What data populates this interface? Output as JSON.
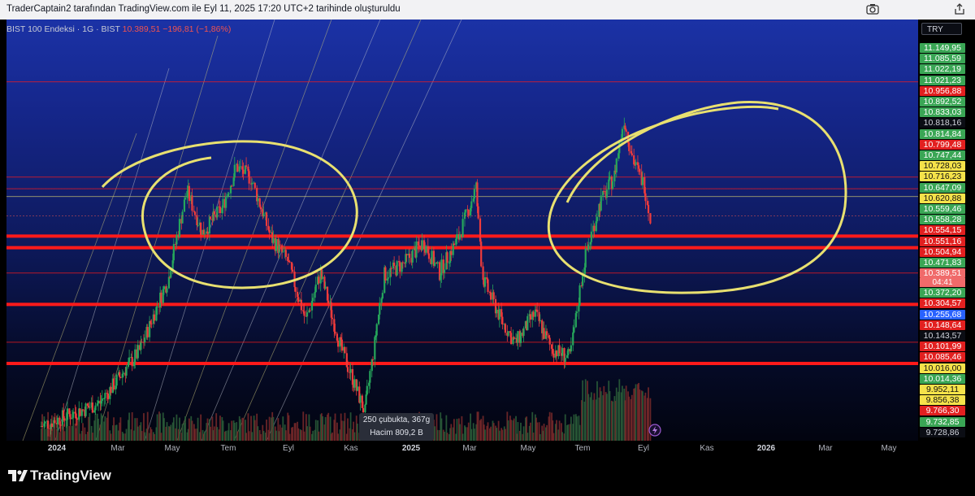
{
  "header": {
    "caption": "TraderCaptain2 tarafından TradingView.com ile Eyl 11, 2025 17:20 UTC+2 tarihinde oluşturuldu"
  },
  "symbol": {
    "name": "BIST 100 Endeksi · 1G · BIST",
    "last": "10.389,51",
    "change": "−196,81 (−1,86%)"
  },
  "currency": "TRY",
  "countdown": "04:41",
  "tooltip": {
    "line1": "250 çubukta, 367g",
    "line2": "Hacim 809,2 B"
  },
  "branding": {
    "logo_text": "TradingView"
  },
  "icons": {
    "camera": "camera-icon",
    "share": "share-icon",
    "bolt": "lightning-icon",
    "logo": "tradingview-logo-icon"
  },
  "colors": {
    "up": "#26a65b",
    "down": "#ef3b3b",
    "support_line": "#ff1a1a",
    "highlight_circle": "#e8e070",
    "volume_down": "#7a2a2a",
    "volume_up": "#2c5f3a"
  },
  "chart_data": {
    "type": "candlestick",
    "symbol": "BIST 100 Endeksi",
    "interval": "1G",
    "price_axis_labels": [
      {
        "text": "11.149,95",
        "color": "green"
      },
      {
        "text": "11.085,59",
        "color": "green"
      },
      {
        "text": "11.022,19",
        "color": "green"
      },
      {
        "text": "11.021,23",
        "color": "green"
      },
      {
        "text": "10.956,88",
        "color": "red"
      },
      {
        "text": "10.892,52",
        "color": "green"
      },
      {
        "text": "10.833,03",
        "color": "green"
      },
      {
        "text": "10.818,16",
        "color": "dark"
      },
      {
        "text": "10.814,84",
        "color": "green"
      },
      {
        "text": "10.799,48",
        "color": "red"
      },
      {
        "text": "10.747,44",
        "color": "green"
      },
      {
        "text": "10.728,03",
        "color": "yellow"
      },
      {
        "text": "10.716,23",
        "color": "yellow"
      },
      {
        "text": "10.647,09",
        "color": "green"
      },
      {
        "text": "10.620,88",
        "color": "yellow"
      },
      {
        "text": "10.559,46",
        "color": "green"
      },
      {
        "text": "10.558,28",
        "color": "green"
      },
      {
        "text": "10.554,15",
        "color": "red"
      },
      {
        "text": "10.551,16",
        "color": "red"
      },
      {
        "text": "10.504,94",
        "color": "red"
      },
      {
        "text": "10.471,83",
        "color": "green"
      },
      {
        "text": "10.389,51",
        "color": "lightred"
      },
      {
        "text": "10.372,20",
        "color": "green"
      },
      {
        "text": "10.304,57",
        "color": "red"
      },
      {
        "text": "10.255,68",
        "color": "blue"
      },
      {
        "text": "10.148,64",
        "color": "red"
      },
      {
        "text": "10.143,57",
        "color": "dark"
      },
      {
        "text": "10.101,99",
        "color": "red"
      },
      {
        "text": "10.085,46",
        "color": "red"
      },
      {
        "text": "10.016,00",
        "color": "yellow"
      },
      {
        "text": "10.014,36",
        "color": "green"
      },
      {
        "text": "9.952,11",
        "color": "yellow"
      },
      {
        "text": "9.856,38",
        "color": "yellow"
      },
      {
        "text": "9.766,30",
        "color": "red"
      },
      {
        "text": "9.732,85",
        "color": "green"
      },
      {
        "text": "9.728,86",
        "color": "dark"
      }
    ],
    "time_axis_labels": [
      {
        "text": "2024",
        "year": true
      },
      {
        "text": "Mar",
        "year": false
      },
      {
        "text": "May",
        "year": false
      },
      {
        "text": "Tem",
        "year": false
      },
      {
        "text": "Eyl",
        "year": false
      },
      {
        "text": "Kas",
        "year": false
      },
      {
        "text": "2025",
        "year": true
      },
      {
        "text": "Mar",
        "year": false
      },
      {
        "text": "May",
        "year": false
      },
      {
        "text": "Tem",
        "year": false
      },
      {
        "text": "Eyl",
        "year": false
      },
      {
        "text": "Kas",
        "year": false
      },
      {
        "text": "2026",
        "year": true
      },
      {
        "text": "Mar",
        "year": false
      },
      {
        "text": "May",
        "year": false
      }
    ],
    "last_price": 10389.51,
    "horizontal_levels": [
      {
        "price": 10956.88,
        "style": "thin"
      },
      {
        "price": 10554.15,
        "style": "thin"
      },
      {
        "price": 10504.94,
        "style": "thin"
      },
      {
        "price": 10304.57,
        "style": "thick"
      },
      {
        "price": 10255.68,
        "style": "thick"
      },
      {
        "price": 10148.64,
        "style": "thin"
      },
      {
        "price": 10016.0,
        "style": "thick"
      },
      {
        "price": 9856.38,
        "style": "thin"
      },
      {
        "price": 9766.3,
        "style": "thick"
      }
    ],
    "price_path_keypoints": [
      {
        "t": "2023-12-20",
        "close": 9500
      },
      {
        "t": "2024-02-20",
        "close": 9600
      },
      {
        "t": "2024-04-01",
        "close": 9820
      },
      {
        "t": "2024-05-01",
        "close": 10130
      },
      {
        "t": "2024-05-20",
        "close": 10500
      },
      {
        "t": "2024-06-05",
        "close": 10320
      },
      {
        "t": "2024-06-25",
        "close": 10420
      },
      {
        "t": "2024-07-10",
        "close": 10600
      },
      {
        "t": "2024-07-25",
        "close": 10550
      },
      {
        "t": "2024-08-15",
        "close": 10300
      },
      {
        "t": "2024-09-01",
        "close": 10200
      },
      {
        "t": "2024-09-20",
        "close": 9950
      },
      {
        "t": "2024-10-05",
        "close": 10150
      },
      {
        "t": "2024-10-25",
        "close": 9850
      },
      {
        "t": "2024-11-20",
        "close": 9560
      },
      {
        "t": "2024-12-10",
        "close": 10140
      },
      {
        "t": "2024-12-31",
        "close": 10190
      },
      {
        "t": "2025-01-20",
        "close": 10280
      },
      {
        "t": "2025-02-05",
        "close": 10150
      },
      {
        "t": "2025-02-25",
        "close": 10300
      },
      {
        "t": "2025-03-15",
        "close": 10510
      },
      {
        "t": "2025-03-22",
        "close": 10130
      },
      {
        "t": "2025-04-10",
        "close": 9950
      },
      {
        "t": "2025-04-25",
        "close": 9850
      },
      {
        "t": "2025-05-15",
        "close": 9980
      },
      {
        "t": "2025-06-01",
        "close": 9830
      },
      {
        "t": "2025-06-20",
        "close": 9790
      },
      {
        "t": "2025-07-05",
        "close": 10200
      },
      {
        "t": "2025-07-20",
        "close": 10430
      },
      {
        "t": "2025-08-05",
        "close": 10560
      },
      {
        "t": "2025-08-15",
        "close": 10800
      },
      {
        "t": "2025-08-25",
        "close": 10620
      },
      {
        "t": "2025-09-05",
        "close": 10520
      },
      {
        "t": "2025-09-11",
        "close": 10389.51
      }
    ],
    "annotations": [
      {
        "type": "ellipse",
        "around": "2024-06 top"
      },
      {
        "type": "ellipse",
        "around": "2025-08 top"
      }
    ]
  }
}
